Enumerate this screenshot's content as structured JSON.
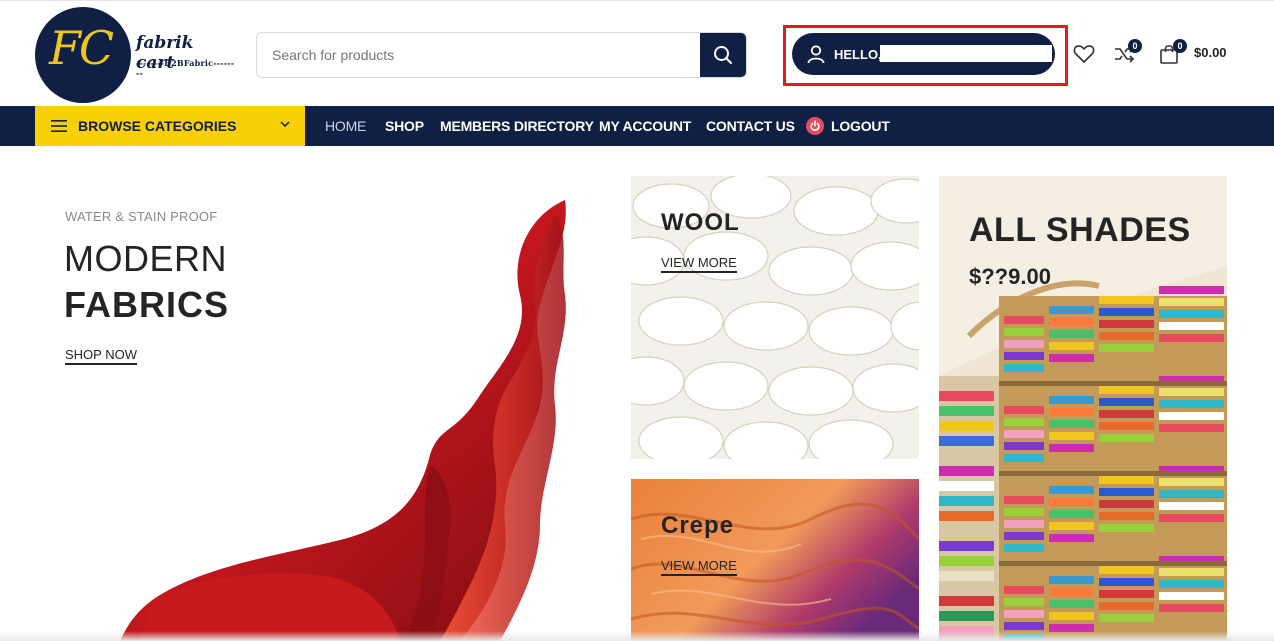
{
  "brand": {
    "logo_initials": "FC",
    "logo_name": "fabrik cart",
    "logo_tagline": "--------B2BFabric--------",
    "colors": {
      "navy": "#0f2044",
      "yellow": "#f8d005",
      "red_highlight": "#e31b23"
    }
  },
  "search": {
    "placeholder": "Search for products",
    "value": "",
    "icon": "search-icon"
  },
  "account": {
    "greeting": "HELLO, A",
    "icon": "user-icon"
  },
  "header_icons": {
    "wishlist_icon": "heart-icon",
    "compare_icon": "compare-icon",
    "compare_count": "0",
    "cart_icon": "shopping-bag-icon",
    "cart_count": "0",
    "cart_total": "$0.00"
  },
  "nav": {
    "browse_label": "BROWSE CATEGORIES",
    "items": [
      {
        "label": "HOME",
        "active": true
      },
      {
        "label": "SHOP"
      },
      {
        "label": "MEMBERS DIRECTORY"
      },
      {
        "label": "MY ACCOUNT"
      },
      {
        "label": "CONTACT US"
      },
      {
        "label": "LOGOUT",
        "icon": "power-icon"
      }
    ]
  },
  "hero": {
    "eyebrow": "WATER & STAIN PROOF",
    "title_line1": "MODERN",
    "title_line2": "FABRICS",
    "cta": "SHOP NOW"
  },
  "tiles": [
    {
      "title": "WOOL",
      "link": "VIEW MORE"
    },
    {
      "title": "Crepe",
      "link": "VIEW MORE"
    },
    {
      "title": "ALL SHADES",
      "price": "$??9.00"
    }
  ]
}
